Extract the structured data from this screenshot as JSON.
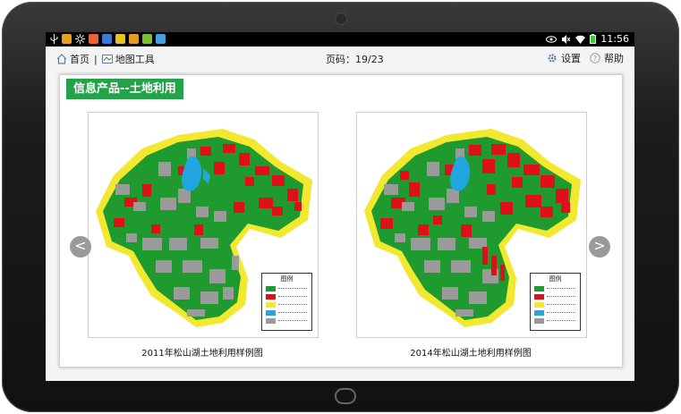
{
  "status_bar": {
    "time": "11:56",
    "left_icons": [
      "usb-icon",
      "app-icon",
      "brightness-icon",
      "app-icon",
      "app-icon",
      "app-icon",
      "app-icon",
      "app-icon",
      "app-icon"
    ],
    "right_icons": [
      "eye-icon",
      "mute-icon",
      "wifi-icon",
      "battery-icon"
    ]
  },
  "toolbar": {
    "home_label": "首页",
    "separator": "|",
    "map_tools_label": "地图工具",
    "page_label": "页码：19/23",
    "settings_label": "设置",
    "help_label": "帮助"
  },
  "panel": {
    "title": "信息产品--土地利用"
  },
  "maps": [
    {
      "caption": "2011年松山湖土地利用样例图",
      "legend_title": "图例"
    },
    {
      "caption": "2014年松山湖土地利用样例图",
      "legend_title": "图例"
    }
  ],
  "legend_colors": [
    "#1f9a2f",
    "#e0101a",
    "#f2e830",
    "#22a6e0",
    "#9a9a9a"
  ],
  "navigation": {
    "prev": "<",
    "next": ">"
  },
  "colors": {
    "banner": "#24a24a",
    "residential": "#e0101a",
    "green": "#1f9a2f",
    "road": "#f2e830",
    "water": "#22a6e0",
    "industrial": "#9a9a9a"
  }
}
